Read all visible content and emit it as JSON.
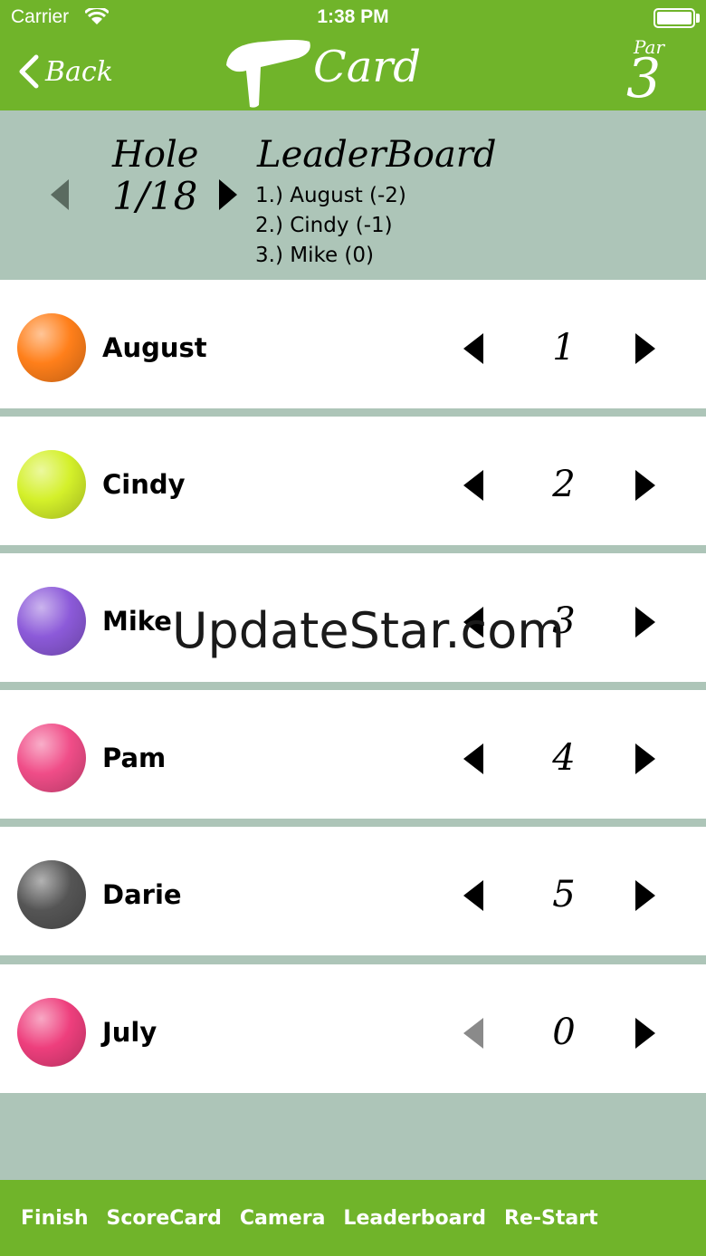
{
  "status": {
    "carrier": "Carrier",
    "time": "1:38 PM"
  },
  "nav": {
    "back_label": "Back",
    "logo_text": "Card",
    "par_label": "Par",
    "par_value": "3"
  },
  "hole": {
    "title": "Hole",
    "value": "1/18"
  },
  "leaderboard": {
    "title": "LeaderBoard",
    "entries": [
      "1.) August (-2)",
      "2.) Cindy (-1)",
      "3.) Mike (0)"
    ]
  },
  "players": [
    {
      "name": "August",
      "score": "1",
      "color": "#ff7f1a"
    },
    {
      "name": "Cindy",
      "score": "2",
      "color": "#d4f02a"
    },
    {
      "name": "Mike",
      "score": "3",
      "color": "#8c5ad9"
    },
    {
      "name": "Pam",
      "score": "4",
      "color": "#f04d88"
    },
    {
      "name": "Darie",
      "score": "5",
      "color": "#555555"
    },
    {
      "name": "July",
      "score": "0",
      "color": "#ee3f7d"
    }
  ],
  "watermark": "UpdateStar.com",
  "tabs": [
    "Finish",
    "ScoreCard",
    "Camera",
    "Leaderboard",
    "Re-Start"
  ],
  "colors": {
    "brand_green": "#70b42a",
    "panel_sage": "#adc5b8"
  }
}
